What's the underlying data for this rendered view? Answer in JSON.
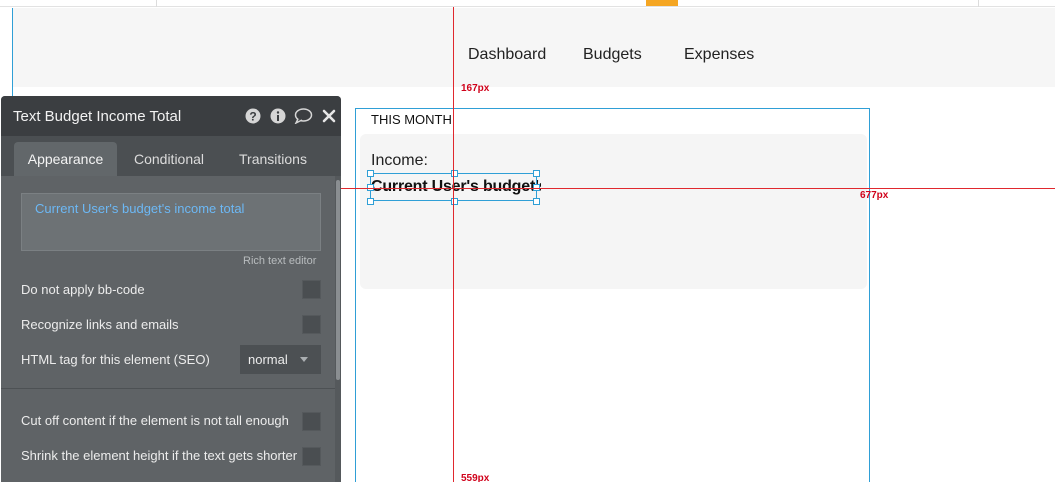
{
  "canvas": {
    "nav": [
      "Dashboard",
      "Budgets",
      "Expenses"
    ],
    "group_title": "THIS MONTH",
    "income_label": "Income:",
    "income_value": "Current User's budget's income total",
    "guides": {
      "vertical_label": "167px",
      "horizontal_label": "677px",
      "bottom_label": "559px"
    }
  },
  "panel": {
    "title": "Text Budget Income Total",
    "icons": [
      "help-icon",
      "info-icon",
      "comment-icon",
      "close-icon"
    ],
    "tabs": [
      "Appearance",
      "Conditional",
      "Transitions"
    ],
    "active_tab": "Appearance",
    "expression": "Current User's budget's income total",
    "rich_text_editor": "Rich text editor",
    "options": [
      "Do not apply bb-code",
      "Recognize links and emails",
      "HTML tag for this element (SEO)",
      "Cut off content if the element is not tall enough",
      "Shrink the element height if the text gets shorter"
    ],
    "html_tag_value": "normal"
  },
  "colors": {
    "guide": "#e0282e",
    "selection": "#2f9fd6",
    "panel_bg": "#5f6366",
    "expression": "#6cb8f5",
    "ruler_marker": "#f5a623"
  }
}
